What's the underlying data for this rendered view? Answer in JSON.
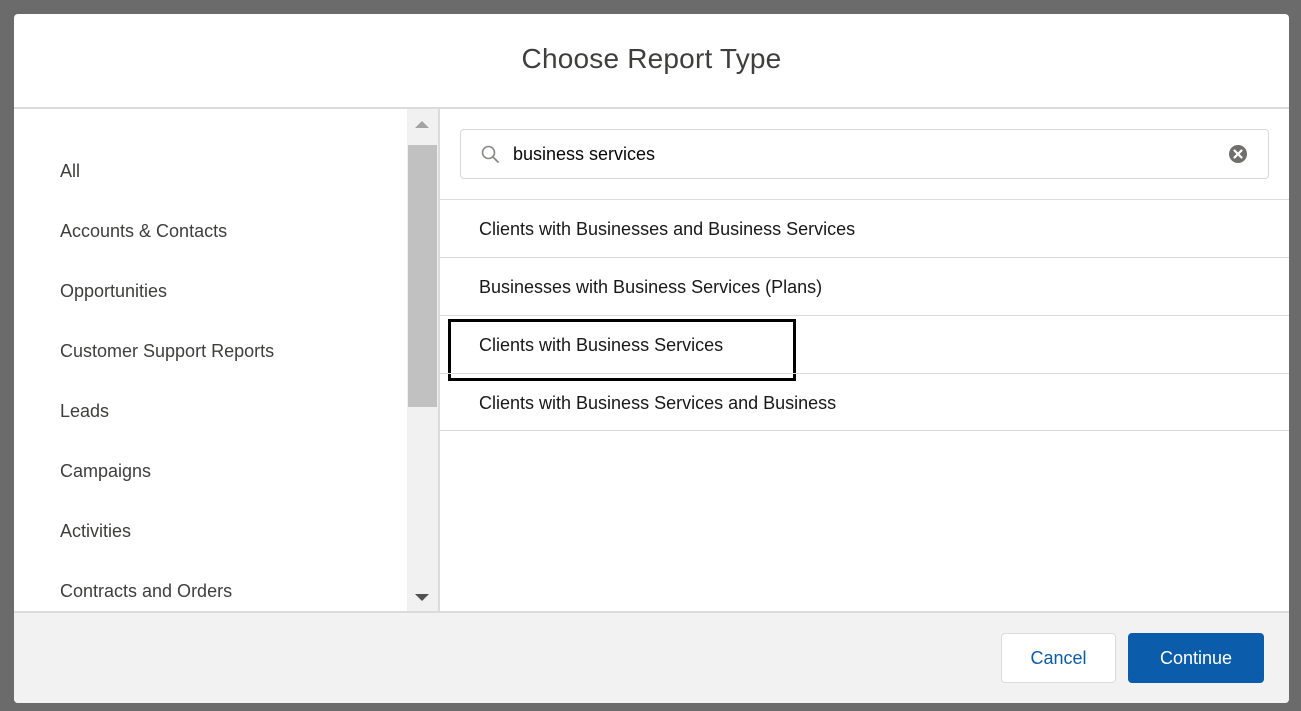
{
  "modal": {
    "title": "Choose Report Type"
  },
  "sidebar": {
    "items": [
      {
        "label": "All"
      },
      {
        "label": "Accounts & Contacts"
      },
      {
        "label": "Opportunities"
      },
      {
        "label": "Customer Support Reports"
      },
      {
        "label": "Leads"
      },
      {
        "label": "Campaigns"
      },
      {
        "label": "Activities"
      },
      {
        "label": "Contracts and Orders"
      }
    ]
  },
  "search": {
    "value": "business services",
    "placeholder": "",
    "icon": "search-icon",
    "clear_icon": "clear-icon"
  },
  "results": [
    {
      "label": "Clients with Businesses and Business Services"
    },
    {
      "label": "Businesses with Business Services (Plans)"
    },
    {
      "label": "Clients with Business Services"
    },
    {
      "label": "Clients with Business Services and Business"
    }
  ],
  "footer": {
    "cancel_label": "Cancel",
    "continue_label": "Continue"
  },
  "colors": {
    "overlay": "#6b6b6b",
    "brand": "#0b5cab",
    "border": "#dddbda",
    "footer_bg": "#f3f2f2",
    "highlight": "#000000"
  }
}
